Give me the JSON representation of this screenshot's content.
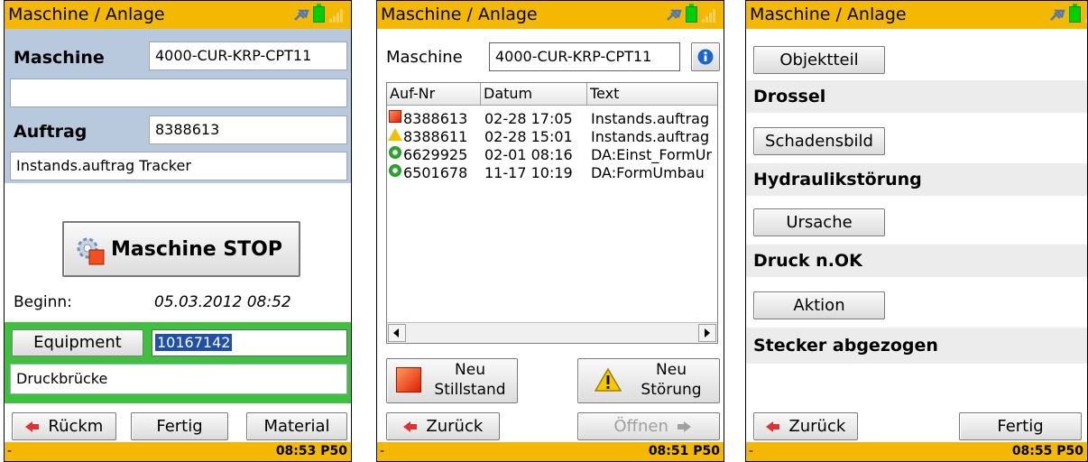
{
  "status": {
    "plug_icon": "plug-icon",
    "battery_icon": "battery-icon",
    "signal_icon": "signal-icon"
  },
  "screen1": {
    "title": "Maschine / Anlage",
    "maschine_label": "Maschine",
    "maschine_value": "4000-CUR-KRP-CPT11",
    "empty_value": "",
    "auftrag_label": "Auftrag",
    "auftrag_value": "8388613",
    "auftrag_text": "Instands.auftrag Tracker",
    "stop_button": "Maschine STOP",
    "beginn_label": "Beginn:",
    "beginn_value": "05.03.2012 08:52",
    "equipment_button": "Equipment",
    "equipment_value": "10167142",
    "equipment_text": "Druckbrücke",
    "rueckm_button": "Rückm",
    "fertig_button": "Fertig",
    "material_button": "Material",
    "footer_left": "-",
    "footer_time": "08:53 P50"
  },
  "screen2": {
    "title": "Maschine / Anlage",
    "maschine_label": "Maschine",
    "maschine_value": "4000-CUR-KRP-CPT11",
    "columns": [
      "Auf-Nr",
      "Datum",
      "Text"
    ],
    "rows": [
      {
        "icon": "stillstand-icon",
        "nr": "8388613",
        "datum": "02-28 17:05",
        "text": "Instands.auftrag"
      },
      {
        "icon": "warning-icon",
        "nr": "8388611",
        "datum": "02-28 15:01",
        "text": "Instands.auftrag"
      },
      {
        "icon": "gear-ok-icon",
        "nr": "6629925",
        "datum": "02-01 08:16",
        "text": "DA:Einst_FormUr"
      },
      {
        "icon": "gear-ok-icon",
        "nr": "6501678",
        "datum": "11-17 10:19",
        "text": "DA:FormUmbau"
      }
    ],
    "neu_stillstand_1": "Neu",
    "neu_stillstand_2": "Stillstand",
    "neu_stoerung_1": "Neu",
    "neu_stoerung_2": "Störung",
    "zurueck_button": "Zurück",
    "oeffnen_button": "Öffnen",
    "footer_left": "-",
    "footer_time": "08:51 P50"
  },
  "screen3": {
    "title": "Maschine / Anlage",
    "objektteil_button": "Objektteil",
    "objektteil_value": "Drossel",
    "schadensbild_button": "Schadensbild",
    "schadensbild_value": "Hydraulikstörung",
    "ursache_button": "Ursache",
    "ursache_value": "Druck n.OK",
    "aktion_button": "Aktion",
    "aktion_value": "Stecker abgezogen",
    "zurueck_button": "Zurück",
    "fertig_button": "Fertig",
    "footer_left": "-",
    "footer_time": "08:55 P50"
  }
}
